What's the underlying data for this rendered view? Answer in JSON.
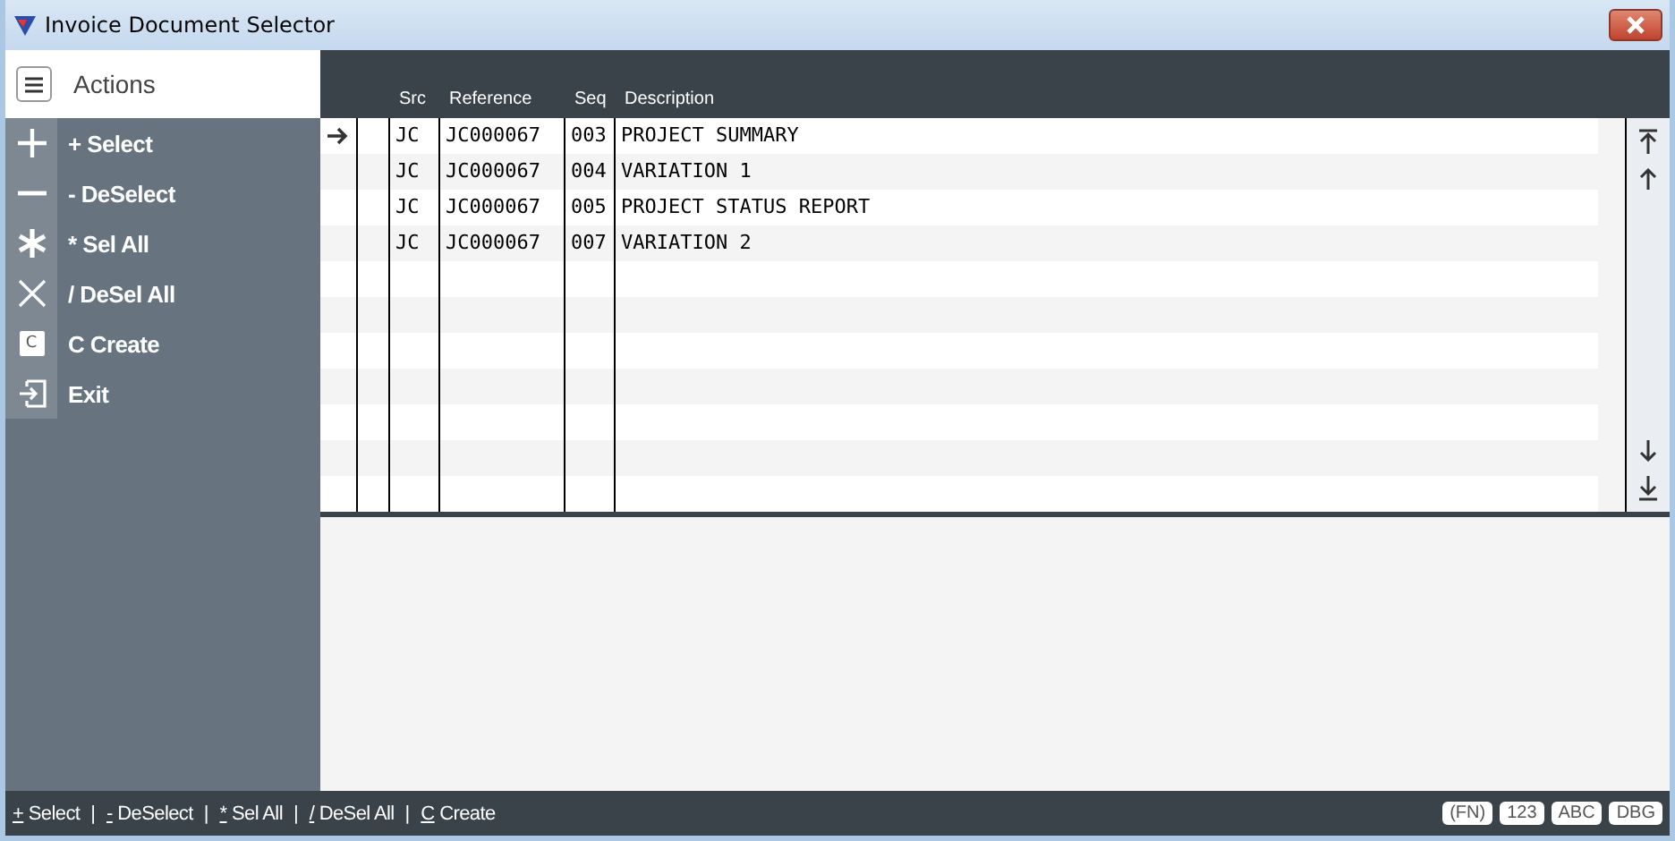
{
  "window": {
    "title": "Invoice Document Selector"
  },
  "sidebar": {
    "title": "Actions",
    "items": [
      {
        "kind": "plus",
        "label": "+ Select"
      },
      {
        "kind": "minus",
        "label": "- DeSelect"
      },
      {
        "kind": "asterisk",
        "label": "* Sel All"
      },
      {
        "kind": "cross",
        "label": "/ DeSel All"
      },
      {
        "kind": "letter",
        "glyph": "C",
        "label": "C Create"
      },
      {
        "kind": "exit",
        "label": "Exit"
      }
    ]
  },
  "table": {
    "columns": [
      "Src",
      "Reference",
      "Seq",
      "Description"
    ],
    "rows": [
      {
        "current": true,
        "cells": [
          "JC",
          "JC000067",
          "003",
          "PROJECT SUMMARY"
        ]
      },
      {
        "current": false,
        "cells": [
          "JC",
          "JC000067",
          "004",
          "VARIATION 1"
        ]
      },
      {
        "current": false,
        "cells": [
          "JC",
          "JC000067",
          "005",
          "PROJECT STATUS REPORT"
        ]
      },
      {
        "current": false,
        "cells": [
          "JC",
          "JC000067",
          "007",
          "VARIATION 2"
        ]
      }
    ]
  },
  "status_bar": {
    "shortcuts": [
      {
        "kind": "shortcut",
        "key": "+",
        "text": " Select"
      },
      {
        "kind": "separator",
        "text": "|"
      },
      {
        "kind": "shortcut",
        "key": "-",
        "text": " DeSelect"
      },
      {
        "kind": "separator",
        "text": "|"
      },
      {
        "kind": "shortcut",
        "key": "*",
        "text": " Sel All"
      },
      {
        "kind": "separator",
        "text": "|"
      },
      {
        "kind": "shortcut",
        "key": "/",
        "text": " DeSel All"
      },
      {
        "kind": "separator",
        "text": "|"
      },
      {
        "kind": "shortcut",
        "key": "C",
        "text": " Create"
      }
    ],
    "badges": [
      "(FN)",
      "123",
      "ABC",
      "DBG"
    ]
  }
}
